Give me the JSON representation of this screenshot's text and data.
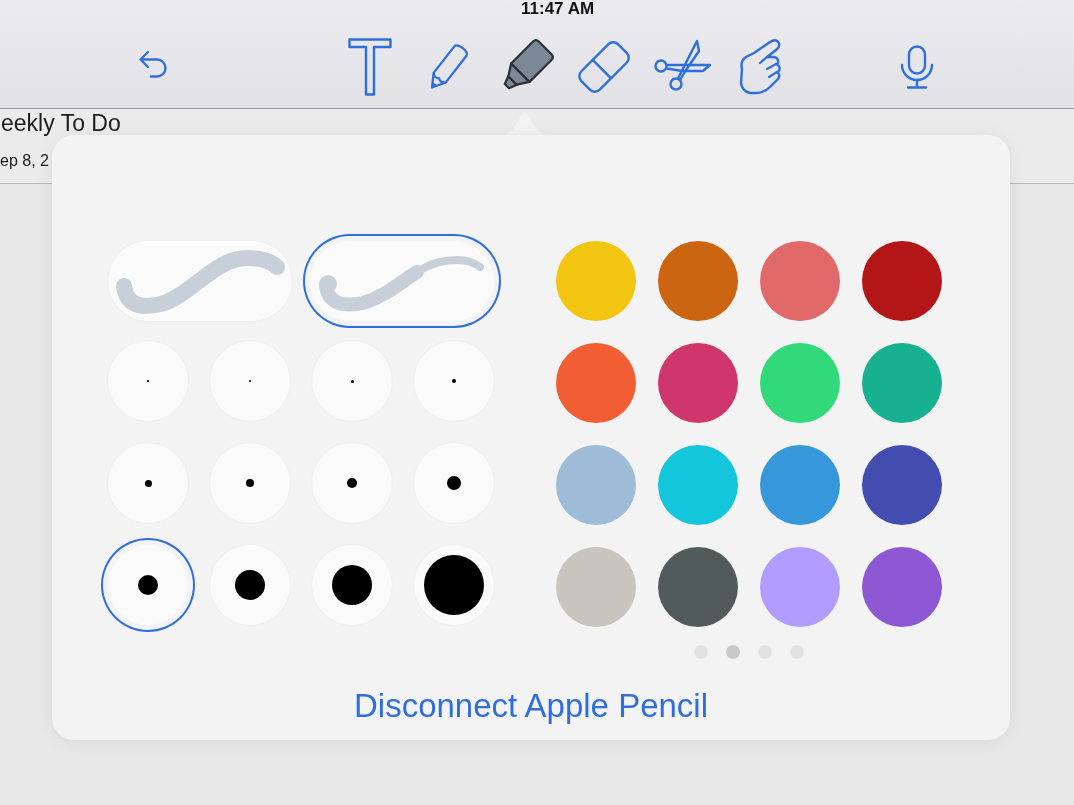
{
  "status_bar": {
    "time": "11:47 AM"
  },
  "toolbar": {
    "tools": [
      {
        "kind": "text",
        "selected": false
      },
      {
        "kind": "pencil",
        "selected": false
      },
      {
        "kind": "highlighter",
        "selected": true
      },
      {
        "kind": "eraser",
        "selected": false
      },
      {
        "kind": "scissors",
        "selected": false
      },
      {
        "kind": "hand",
        "selected": false
      }
    ]
  },
  "document": {
    "title": "eekly To Do",
    "date": "ep 8, 2"
  },
  "popover": {
    "stroke_styles": [
      {
        "kind": "uniform",
        "selected": false
      },
      {
        "kind": "tapered",
        "selected": true
      }
    ],
    "sizes": [
      {
        "selected": false
      },
      {
        "selected": false
      },
      {
        "selected": false
      },
      {
        "selected": false
      },
      {
        "selected": false
      },
      {
        "selected": false
      },
      {
        "selected": false
      },
      {
        "selected": false
      },
      {
        "selected": true
      },
      {
        "selected": false
      },
      {
        "selected": false
      },
      {
        "selected": false
      }
    ],
    "colors": [
      {
        "color": "#f2c511",
        "selected": false
      },
      {
        "color": "#cb6511",
        "selected": false
      },
      {
        "color": "#e2696a",
        "selected": false
      },
      {
        "color": "#b41516",
        "selected": false
      },
      {
        "color": "#f15e33",
        "selected": false
      },
      {
        "color": "#cf366c",
        "selected": false
      },
      {
        "color": "#32d97a",
        "selected": false
      },
      {
        "color": "#17b18f",
        "selected": false
      },
      {
        "color": "#9ebbd8",
        "selected": false
      },
      {
        "color": "#14c6dc",
        "selected": false
      },
      {
        "color": "#3698db",
        "selected": false
      },
      {
        "color": "#424daf",
        "selected": false
      },
      {
        "color": "#c8c5bf",
        "selected": false
      },
      {
        "color": "#515c5a",
        "selected": false
      },
      {
        "color": "#b19cff",
        "selected": false
      },
      {
        "color": "#8e57d4",
        "selected": false
      }
    ],
    "page_dots": [
      {
        "selected": false
      },
      {
        "selected": true
      },
      {
        "selected": false
      },
      {
        "selected": false
      }
    ],
    "action": "Disconnect Apple Pencil"
  }
}
